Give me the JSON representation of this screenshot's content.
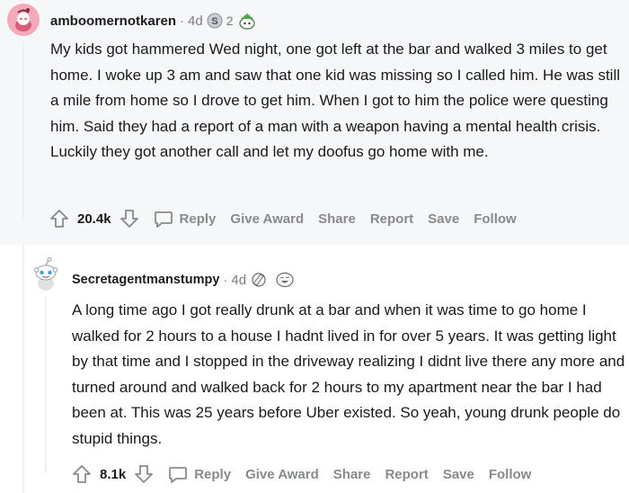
{
  "comments": [
    {
      "username": "amboomernotkaren",
      "separator": "·",
      "time": "4d",
      "award_count": "2",
      "body": "My kids got hammered Wed night, one got left at the bar and walked 3 miles to get home. I woke up 3 am and saw that one kid was missing so I called him. He was still a mile from home so I drove to get him. When I got to him the police were questing him. Said they had a report of a man with a weapon having a mental health crisis. Luckily they got another call and let my doofus go home with me.",
      "score": "20.4k",
      "actions": {
        "reply": "Reply",
        "give_award": "Give Award",
        "share": "Share",
        "report": "Report",
        "save": "Save",
        "follow": "Follow"
      }
    },
    {
      "username": "Secretagentmanstumpy",
      "separator": "·",
      "time": "4d",
      "body": "A long time ago I got really drunk at a bar and when it was time to go home I walked for 2 hours to a house I hadnt lived in for over 5 years. It was getting light by that time and I stopped in the driveway realizing I didnt live there any more and turned around and walked back for 2 hours to my apartment near the bar I had been at. This was 25 years before Uber existed. So yeah, young drunk people do stupid things.",
      "score": "8.1k",
      "actions": {
        "reply": "Reply",
        "give_award": "Give Award",
        "share": "Share",
        "report": "Report",
        "save": "Save",
        "follow": "Follow"
      }
    }
  ],
  "colors": {
    "comment1_bg": "#f6f7f8",
    "action_gray": "#878a8c",
    "text": "#1a1a1b"
  }
}
